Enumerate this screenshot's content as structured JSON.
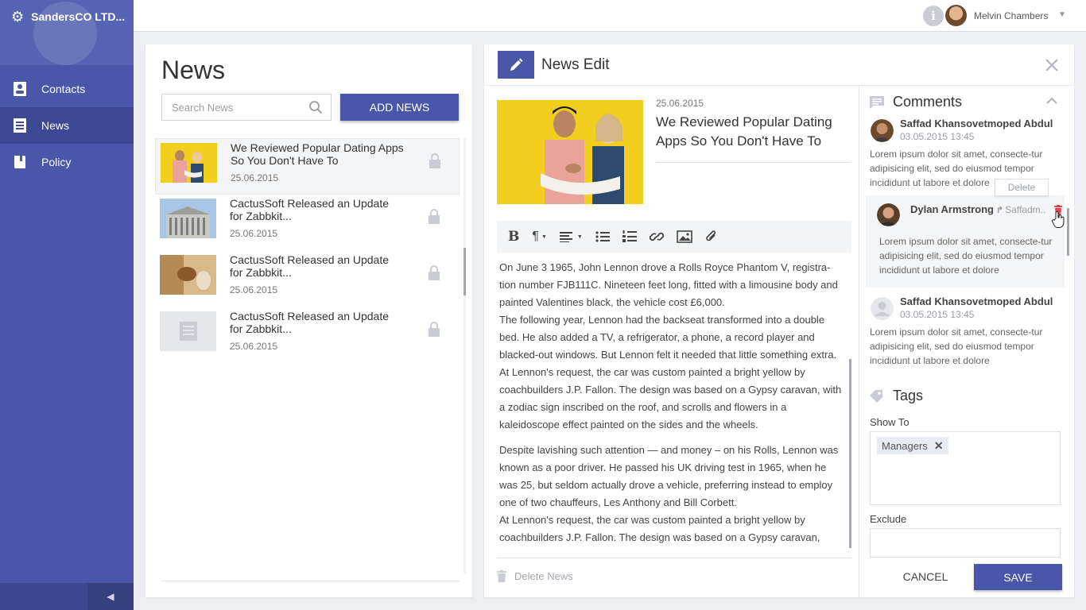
{
  "brand": {
    "name": "SandersCO LTD..."
  },
  "sidebar": {
    "items": [
      {
        "label": "Contacts",
        "icon": "contacts-icon"
      },
      {
        "label": "News",
        "icon": "news-icon"
      },
      {
        "label": "Policy",
        "icon": "book-icon"
      }
    ],
    "active": "News"
  },
  "topbar": {
    "info_glyph": "i",
    "user_name": "Melvin Chambers"
  },
  "news": {
    "title": "News",
    "search_placeholder": "Search News",
    "add_label": "ADD NEWS",
    "items": [
      {
        "title": "We Reviewed Popular Dating Apps So You Don't Have To",
        "date": "25.06.2015"
      },
      {
        "title": "CactusSoft Released an Update for Zabbkit...",
        "date": "25.06.2015"
      },
      {
        "title": "CactusSoft Released an Update for Zabbkit...",
        "date": "25.06.2015"
      },
      {
        "title": "CactusSoft Released an Update for Zabbkit...",
        "date": "25.06.2015"
      }
    ]
  },
  "edit": {
    "title": "News Edit",
    "article": {
      "date": "25.06.2015",
      "title": "We Reviewed Popular Dating Apps So You Don't Have To",
      "paragraphs": [
        "On June 3 1965, John Lennon drove a Rolls Royce Phantom V, registra-tion number FJB111C. Nineteen feet long, fitted with a limousine body and painted Valentines black, the vehicle cost £6,000.",
        "The following year, Lennon had the backseat transformed into a double bed. He also added a TV, a refrigerator, a phone, a record player and blacked-out windows. But Lennon felt it needed that little something extra. At Lennon's request, the car was custom painted a bright yellow by coachbuilders J.P. Fallon. The design was based on a Gypsy caravan, with a zodiac sign inscribed on the roof, and scrolls and flowers in a kaleidoscope effect painted on the sides and the wheels.",
        "Despite lavishing such attention — and money – on his Rolls, Lennon was known as a poor driver. He passed his UK driving test in 1965, when he was 25, but seldom actually drove a vehicle, preferring instead to employ one of two chauffeurs, Les Anthony and Bill Corbett.",
        "At Lennon's request, the car was custom painted a bright yellow by coachbuilders J.P. Fallon. The design was based on a Gypsy caravan,"
      ]
    },
    "delete_label": "Delete News",
    "cancel_label": "CANCEL",
    "save_label": "SAVE"
  },
  "comments": {
    "title": "Comments",
    "delete_tooltip": "Delete",
    "items": [
      {
        "name": "Saffad Khansovetmoped Abdul",
        "date": "03.05.2015  13:45",
        "text": "Lorem ipsum dolor sit amet, consecte-tur adipisicing elit, sed do eiusmod tempor incididunt ut labore et dolore"
      },
      {
        "name": "Dylan Armstrong",
        "reply_to": "Saffadm..",
        "text": "Lorem ipsum dolor sit amet, consecte-tur adipisicing elit, sed do eiusmod tempor incididunt ut labore et dolore"
      },
      {
        "name": "Saffad Khansovetmoped Abdul",
        "date": "03.05.2015  13:45",
        "text": "Lorem ipsum dolor sit amet, consecte-tur adipisicing elit, sed do eiusmod tempor incididunt ut labore et dolore"
      }
    ]
  },
  "tags": {
    "title": "Tags",
    "show_to_label": "Show To",
    "show_to": [
      "Managers"
    ],
    "exclude_label": "Exclude"
  },
  "colors": {
    "accent": "#4a56a8",
    "sidebar_bg": "#4a56a8",
    "delete_red": "#e8434b",
    "thumb_yellow": "#f2cf1e"
  }
}
